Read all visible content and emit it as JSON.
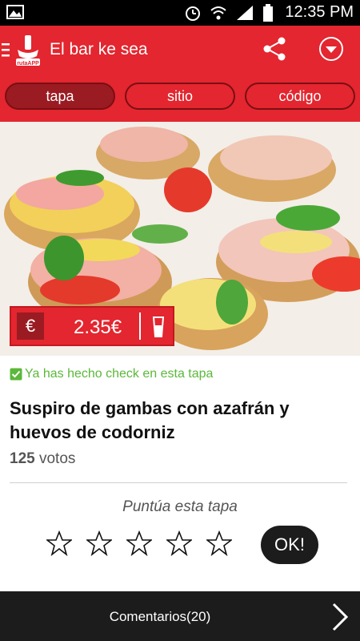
{
  "status_bar": {
    "time": "12:35 PM"
  },
  "app_bar": {
    "title": "El bar ke sea",
    "logo_text": "rutaAPP"
  },
  "tabs": [
    {
      "label": "tapa",
      "active": true
    },
    {
      "label": "sitio",
      "active": false
    },
    {
      "label": "código",
      "active": false
    }
  ],
  "price": {
    "currency": "€",
    "amount": "2.35€"
  },
  "check_message": "Ya has hecho check en esta tapa",
  "dish": {
    "name": "Suspiro de gambas con azafrán y huevos de codorniz",
    "votes_count": "125",
    "votes_label": "votos"
  },
  "rating": {
    "label": "Puntúa esta tapa",
    "stars": 5,
    "ok_label": "OK!"
  },
  "bottom_bar": {
    "comments_label": "Comentarios(20)"
  },
  "colors": {
    "brand_red": "#e3262f",
    "dark_red": "#9b1b22",
    "check_green": "#5bb83a",
    "bottom_bar": "#1c1c1c"
  },
  "icons": [
    "image-icon",
    "alarm-icon",
    "wifi-icon",
    "signal-icon",
    "battery-icon",
    "menu-icon",
    "share-icon",
    "dropdown-icon",
    "euro-icon",
    "glass-icon",
    "check-icon",
    "star-icon",
    "chevron-right-icon"
  ]
}
